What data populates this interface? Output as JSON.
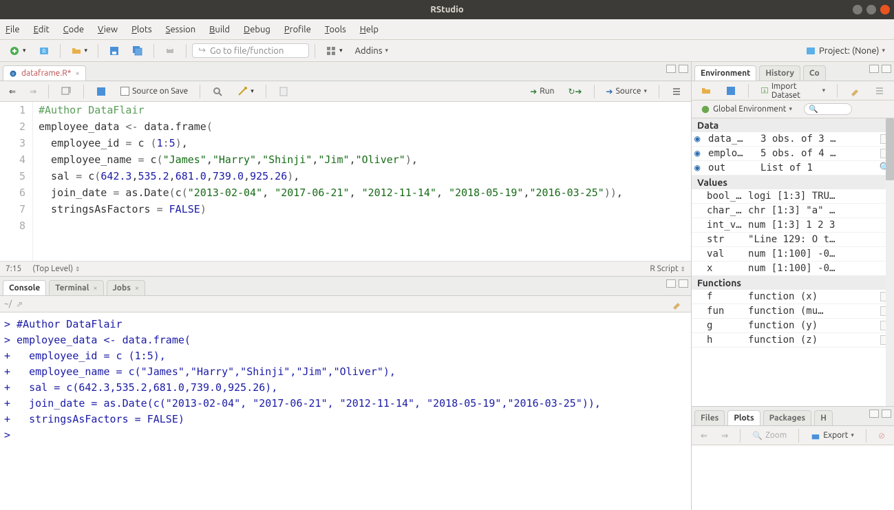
{
  "titlebar": {
    "title": "RStudio"
  },
  "menubar": [
    "File",
    "Edit",
    "Code",
    "View",
    "Plots",
    "Session",
    "Build",
    "Debug",
    "Profile",
    "Tools",
    "Help"
  ],
  "toolbar": {
    "gotofile_placeholder": "Go to file/function",
    "addins": "Addins",
    "project_label": "Project: (None)"
  },
  "source": {
    "tab_label": "dataframe.R*",
    "source_on_save": "Source on Save",
    "run_label": "Run",
    "source_label": "Source",
    "cursor_pos": "7:15",
    "scope": "(Top Level)",
    "file_type": "R Script",
    "lines": [
      {
        "n": 1,
        "html": "<span class='c-comment'>#Author DataFlair</span>"
      },
      {
        "n": 2,
        "html": "employee_data <span class='c-op'>&lt;-</span> data.frame<span class='c-paren'>(</span>"
      },
      {
        "n": 3,
        "html": "  employee_id <span class='c-op'>=</span> c <span class='c-paren'>(</span><span class='c-num'>1</span><span class='c-op'>:</span><span class='c-num'>5</span><span class='c-paren'>)</span>,"
      },
      {
        "n": 4,
        "html": "  employee_name <span class='c-op'>=</span> c<span class='c-paren'>(</span><span class='c-str'>\"James\"</span>,<span class='c-str'>\"Harry\"</span>,<span class='c-str'>\"Shinji\"</span>,<span class='c-str'>\"Jim\"</span>,<span class='c-str'>\"Oliver\"</span><span class='c-paren'>)</span>,"
      },
      {
        "n": 5,
        "html": "  sal <span class='c-op'>=</span> c<span class='c-paren'>(</span><span class='c-num'>642.3</span>,<span class='c-num'>535.2</span>,<span class='c-num'>681.0</span>,<span class='c-num'>739.0</span>,<span class='c-num'>925.26</span><span class='c-paren'>)</span>,"
      },
      {
        "n": 6,
        "html": "  join_date <span class='c-op'>=</span> as.Date<span class='c-paren'>(</span>c<span class='c-paren'>(</span><span class='c-str'>\"2013-02-04\"</span>, <span class='c-str'>\"2017-06-21\"</span>, <span class='c-str'>\"2012-11-14\"</span>, <span class='c-str'>\"2018-05-19\"</span>,<span class='c-str'>\"2016-03-25\"</span><span class='c-paren'>))</span>,"
      },
      {
        "n": 7,
        "html": "  stringsAsFactors <span class='c-op'>=</span> <span class='c-kw'>FALSE</span><span class='c-paren'>)</span>"
      },
      {
        "n": 8,
        "html": ""
      }
    ]
  },
  "console": {
    "tabs": [
      "Console",
      "Terminal",
      "Jobs"
    ],
    "active": 0,
    "prompt_path": "~/",
    "lines": [
      "> #Author DataFlair",
      "> employee_data <- data.frame(",
      "+   employee_id = c (1:5),",
      "+   employee_name = c(\"James\",\"Harry\",\"Shinji\",\"Jim\",\"Oliver\"),",
      "+   sal = c(642.3,535.2,681.0,739.0,925.26),",
      "+   join_date = as.Date(c(\"2013-02-04\", \"2017-06-21\", \"2012-11-14\", \"2018-05-19\",\"2016-03-25\")),",
      "+   stringsAsFactors = FALSE)",
      "> "
    ]
  },
  "env": {
    "tabs": [
      "Environment",
      "History",
      "Co"
    ],
    "active": 0,
    "import_label": "Import Dataset",
    "scope": "Global Environment",
    "sections": [
      {
        "title": "Data",
        "rows": [
          {
            "icon": "expand",
            "name": "data_…",
            "val": "3 obs. of 3 …",
            "action": true
          },
          {
            "icon": "expand",
            "name": "emplo…",
            "val": "5 obs. of 4 …",
            "action": true
          },
          {
            "icon": "expand",
            "name": "out",
            "val": "List of 1",
            "action": "search"
          }
        ]
      },
      {
        "title": "Values",
        "rows": [
          {
            "name": "bool_…",
            "val": "logi [1:3] TRU…"
          },
          {
            "name": "char_…",
            "val": "chr [1:3] \"a\" …"
          },
          {
            "name": "int_v…",
            "val": "num [1:3] 1 2 3"
          },
          {
            "name": "str",
            "val": "\"Line 129: O t…"
          },
          {
            "name": "val",
            "val": "num [1:100] -0…"
          },
          {
            "name": "x",
            "val": "num [1:100] -0…"
          }
        ]
      },
      {
        "title": "Functions",
        "rows": [
          {
            "name": "f",
            "val": "function (x)",
            "action": true
          },
          {
            "name": "fun",
            "val": "function (mu…",
            "action": true
          },
          {
            "name": "g",
            "val": "function (y)",
            "action": true
          },
          {
            "name": "h",
            "val": "function (z)",
            "action": true
          }
        ]
      }
    ]
  },
  "plots": {
    "tabs": [
      "Files",
      "Plots",
      "Packages",
      "H"
    ],
    "active": 1,
    "zoom": "Zoom",
    "export": "Export"
  }
}
